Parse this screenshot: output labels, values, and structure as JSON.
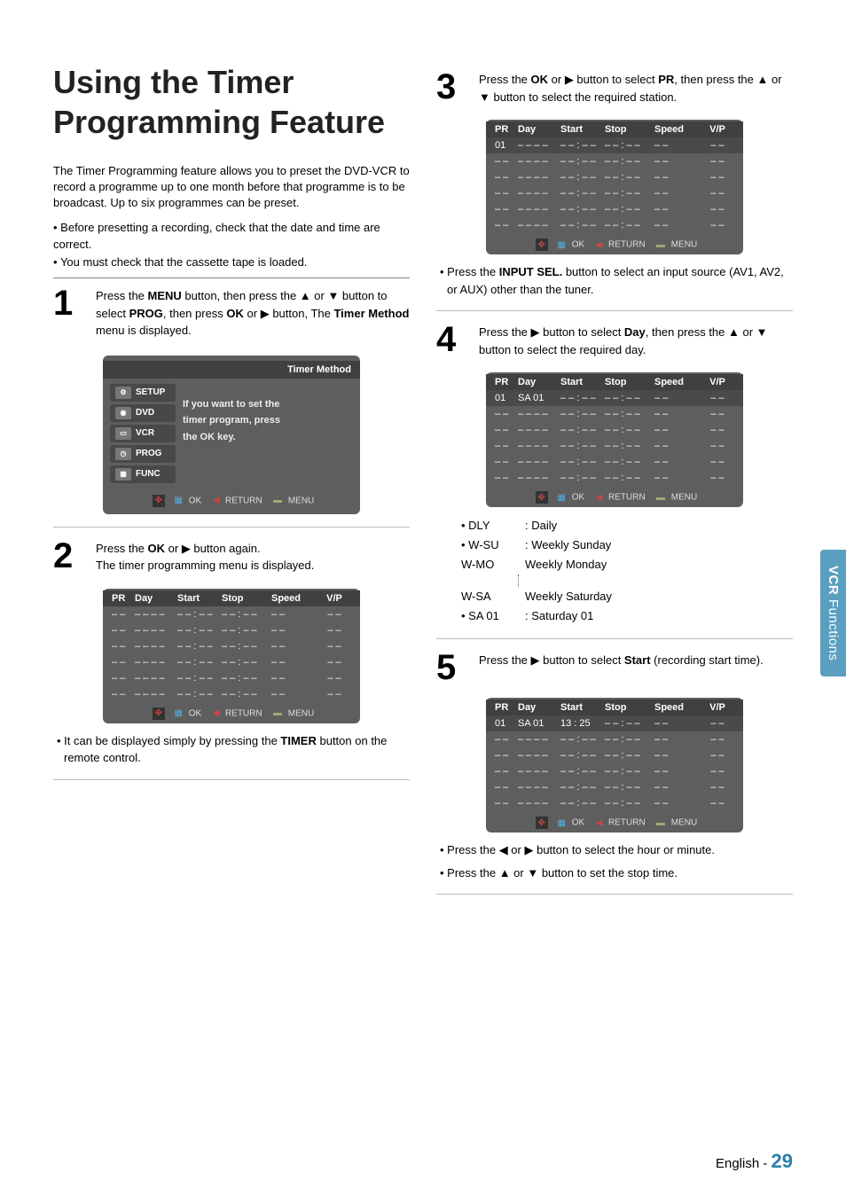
{
  "side_tab": {
    "part1": "VCR ",
    "part2": "Functions"
  },
  "title": "Using the Timer Programming Feature",
  "intro1": "The Timer Programming feature allows you to preset the DVD-VCR to record a programme up to one month before that programme is to be broadcast. Up to six programmes can be preset.",
  "intro_bullets": [
    "Before presetting a recording, check that the date and time are correct.",
    "You must check that the cassette tape is loaded."
  ],
  "step1": {
    "num": "1",
    "text_a": "Press the ",
    "menu_b": "MENU",
    "text_b": " button, then press the ▲ or ▼ button to select ",
    "prog_b": "PROG",
    "text_c": ", then press ",
    "ok_b": "OK",
    "text_d": " or ▶ button, The ",
    "tm_b": "Timer Method",
    "text_e": " menu is displayed."
  },
  "osd_menu": {
    "header": "Timer Method",
    "items": [
      "SETUP",
      "DVD",
      "VCR",
      "PROG",
      "FUNC"
    ],
    "msg_l1": "If you want to set the",
    "msg_l2": "timer program, press",
    "msg_l3": "the  OK  key.",
    "footer_ok": "OK",
    "footer_return": "RETURN",
    "footer_menu": "MENU"
  },
  "step2": {
    "num": "2",
    "text_a": "Press the ",
    "ok_b": "OK",
    "text_b": " or ▶ button again.",
    "text_c": "The timer programming menu is displayed."
  },
  "step2_note_a": "It can be displayed simply by pressing the ",
  "step2_note_b": "TIMER",
  "step2_note_c": " button on the remote control.",
  "table_cols": {
    "pr": "PR",
    "day": "Day",
    "start": "Start",
    "stop": "Stop",
    "speed": "Speed",
    "vp": "V/P"
  },
  "osd2_rows": [
    {
      "pr": "– –",
      "day": "– –  – –",
      "start": "– – : – –",
      "stop": "– – : – –",
      "speed": "– –",
      "vp": "– –"
    },
    {
      "pr": "– –",
      "day": "– –  – –",
      "start": "– – : – –",
      "stop": "– – : – –",
      "speed": "– –",
      "vp": "– –"
    },
    {
      "pr": "– –",
      "day": "– –  – –",
      "start": "– – : – –",
      "stop": "– – : – –",
      "speed": "– –",
      "vp": "– –"
    },
    {
      "pr": "– –",
      "day": "– –  – –",
      "start": "– – : – –",
      "stop": "– – : – –",
      "speed": "– –",
      "vp": "– –"
    },
    {
      "pr": "– –",
      "day": "– –  – –",
      "start": "– – : – –",
      "stop": "– – : – –",
      "speed": "– –",
      "vp": "– –"
    },
    {
      "pr": "– –",
      "day": "– –  – –",
      "start": "– – : – –",
      "stop": "– – : – –",
      "speed": "– –",
      "vp": "– –"
    }
  ],
  "step3": {
    "num": "3",
    "text_a": "Press the ",
    "ok_b": "OK",
    "text_b": " or ▶ button to select ",
    "pr_b": "PR",
    "text_c": ", then press the ▲ or ▼ button to select the required station."
  },
  "osd3_rows": [
    {
      "pr": "01",
      "day": "– –  – –",
      "start": "– – : – –",
      "stop": "– – : – –",
      "speed": "– –",
      "vp": "– –"
    },
    {
      "pr": "– –",
      "day": "– –  – –",
      "start": "– – : – –",
      "stop": "– – : – –",
      "speed": "– –",
      "vp": "– –"
    },
    {
      "pr": "– –",
      "day": "– –  – –",
      "start": "– – : – –",
      "stop": "– – : – –",
      "speed": "– –",
      "vp": "– –"
    },
    {
      "pr": "– –",
      "day": "– –  – –",
      "start": "– – : – –",
      "stop": "– – : – –",
      "speed": "– –",
      "vp": "– –"
    },
    {
      "pr": "– –",
      "day": "– –  – –",
      "start": "– – : – –",
      "stop": "– – : – –",
      "speed": "– –",
      "vp": "– –"
    },
    {
      "pr": "– –",
      "day": "– –  – –",
      "start": "– – : – –",
      "stop": "– – : – –",
      "speed": "– –",
      "vp": "– –"
    }
  ],
  "step3_note_a": "Press the ",
  "step3_note_b": "INPUT SEL.",
  "step3_note_c": " button to select an input source (AV1, AV2, or AUX) other than the tuner.",
  "step4": {
    "num": "4",
    "text_a": "Press the ▶ button to select ",
    "day_b": "Day",
    "text_b": ", then press the ▲ or ▼ button to select the required day."
  },
  "osd4_rows": [
    {
      "pr": "01",
      "day": "SA  01",
      "start": "– – : – –",
      "stop": "– – : – –",
      "speed": "– –",
      "vp": "– –"
    },
    {
      "pr": "– –",
      "day": "– –  – –",
      "start": "– – : – –",
      "stop": "– – : – –",
      "speed": "– –",
      "vp": "– –"
    },
    {
      "pr": "– –",
      "day": "– –  – –",
      "start": "– – : – –",
      "stop": "– – : – –",
      "speed": "– –",
      "vp": "– –"
    },
    {
      "pr": "– –",
      "day": "– –  – –",
      "start": "– – : – –",
      "stop": "– – : – –",
      "speed": "– –",
      "vp": "– –"
    },
    {
      "pr": "– –",
      "day": "– –  – –",
      "start": "– – : – –",
      "stop": "– – : – –",
      "speed": "– –",
      "vp": "– –"
    },
    {
      "pr": "– –",
      "day": "– –  – –",
      "start": "– – : – –",
      "stop": "– – : – –",
      "speed": "– –",
      "vp": "– –"
    }
  ],
  "day_legend": [
    {
      "k": "• DLY",
      "v": ": Daily"
    },
    {
      "k": "• W-SU",
      "v": ": Weekly Sunday"
    },
    {
      "k": "  W-MO",
      "v": "  Weekly Monday"
    },
    {
      "k": "  W-SA",
      "v": "  Weekly Saturday"
    },
    {
      "k": "• SA 01",
      "v": ": Saturday 01"
    }
  ],
  "step5": {
    "num": "5",
    "text_a": "Press the ▶ button to select ",
    "start_b": "Start",
    "text_b": " (recording start time)."
  },
  "osd5_rows": [
    {
      "pr": "01",
      "day": "SA  01",
      "start": "13 : 25",
      "stop": "– – : – –",
      "speed": "– –",
      "vp": "– –"
    },
    {
      "pr": "– –",
      "day": "– –  – –",
      "start": "– – : – –",
      "stop": "– – : – –",
      "speed": "– –",
      "vp": "– –"
    },
    {
      "pr": "– –",
      "day": "– –  – –",
      "start": "– – : – –",
      "stop": "– – : – –",
      "speed": "– –",
      "vp": "– –"
    },
    {
      "pr": "– –",
      "day": "– –  – –",
      "start": "– – : – –",
      "stop": "– – : – –",
      "speed": "– –",
      "vp": "– –"
    },
    {
      "pr": "– –",
      "day": "– –  – –",
      "start": "– – : – –",
      "stop": "– – : – –",
      "speed": "– –",
      "vp": "– –"
    },
    {
      "pr": "– –",
      "day": "– –  – –",
      "start": "– – : – –",
      "stop": "– – : – –",
      "speed": "– –",
      "vp": "– –"
    }
  ],
  "step5_bullets": [
    "Press the ◀ or ▶ button to select the hour or minute.",
    "Press the ▲ or ▼ button to set the stop time."
  ],
  "foot": {
    "lang": "English",
    "sep": "- ",
    "num": "29"
  }
}
